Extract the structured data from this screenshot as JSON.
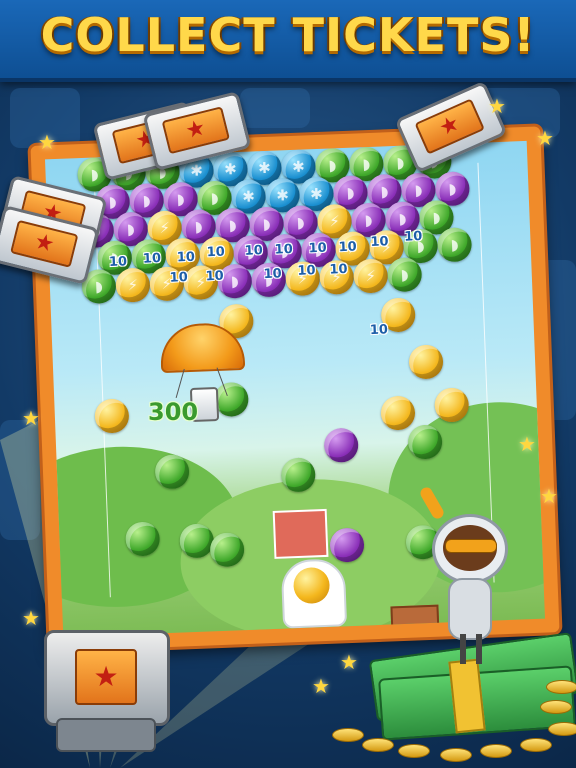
{
  "header": {
    "title": "COLLECT TICKETS!"
  },
  "game": {
    "score_popup": "300",
    "point_label": "10",
    "colors": {
      "banner": "#1565b4",
      "title": "#ffd84a",
      "frame": "#f08b2a",
      "purple": "#8a2fb8",
      "green": "#3fa82a",
      "blue": "#1a8fd0",
      "gold": "#f4b71d"
    }
  }
}
